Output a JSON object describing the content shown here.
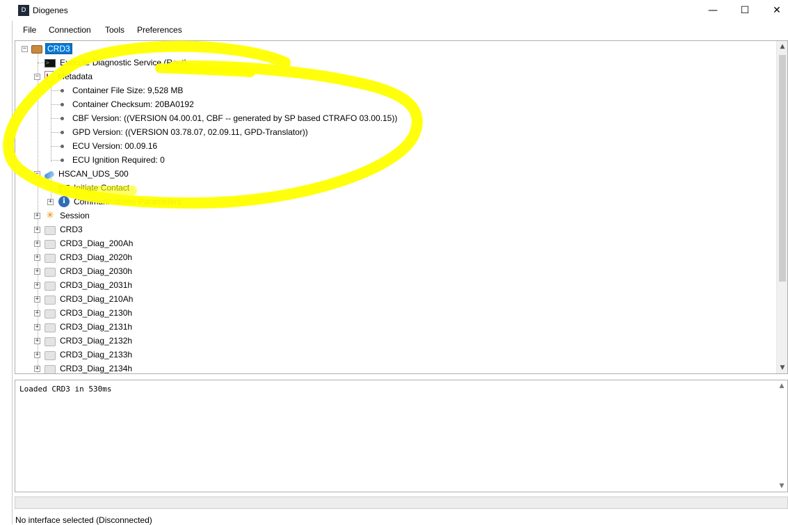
{
  "window": {
    "title": "Diogenes",
    "icon_glyph": "D",
    "controls": {
      "minimize": "—",
      "maximize": "☐",
      "close": "✕"
    }
  },
  "menu": [
    "File",
    "Connection",
    "Tools",
    "Preferences"
  ],
  "tree": {
    "root": "CRD3",
    "execute_service": "Execute Diagnostic Service (Root)",
    "metadata_label": "Metadata",
    "metadata_items": [
      "Container File Size: 9,528 MB",
      "Container Checksum: 20BA0192",
      "CBF Version: ((VERSION 04.00.01, CBF -- generated by SP based CTRAFO 03.00.15))",
      "GPD Version: ((VERSION 03.78.07, 02.09.11, GPD-Translator))",
      "ECU Version: 00.09.16",
      "ECU Ignition Required: 0"
    ],
    "interface_label": "HSCAN_UDS_500",
    "initiate_contact": "Initiate Contact",
    "comm_params": "Communications Parameters",
    "session": "Session",
    "services": [
      "CRD3",
      "CRD3_Diag_200Ah",
      "CRD3_Diag_2020h",
      "CRD3_Diag_2030h",
      "CRD3_Diag_2031h",
      "CRD3_Diag_210Ah",
      "CRD3_Diag_2130h",
      "CRD3_Diag_2131h",
      "CRD3_Diag_2132h",
      "CRD3_Diag_2133h",
      "CRD3_Diag_2134h"
    ]
  },
  "log": {
    "text": "Loaded CRD3 in 530ms"
  },
  "status": {
    "text": "No interface selected (Disconnected)"
  },
  "colors": {
    "selection": "#0078d7",
    "highlighter": "#ffff00"
  },
  "icons": {
    "root": "folder-icon",
    "execute": "terminal-icon",
    "metadata": "document-icon",
    "interface": "plug-icon",
    "initiate": "contact-icon",
    "comm_params": "info-icon",
    "session": "sun-icon",
    "service": "cube-icon"
  }
}
